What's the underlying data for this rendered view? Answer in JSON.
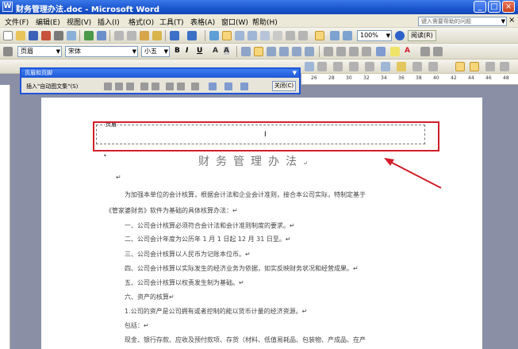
{
  "window": {
    "title": "财务管理办法.doc - Microsoft Word",
    "controls": {
      "minimize": "_",
      "maximize": "□",
      "close": "×"
    }
  },
  "menu": {
    "items": [
      "文件(F)",
      "编辑(E)",
      "视图(V)",
      "插入(I)",
      "格式(O)",
      "工具(T)",
      "表格(A)",
      "窗口(W)",
      "帮助(H)"
    ],
    "help_placeholder": "键入需要帮助的问题",
    "close_glyph": "×"
  },
  "toolbar": {
    "zoom": "100%",
    "read_label": "阅读(R)",
    "style": "页眉",
    "font": "宋体",
    "size": "小五",
    "bold": "B",
    "italic": "I",
    "underline": "U",
    "font_a": "A"
  },
  "header_footer_toolbar": {
    "title": "页眉和页脚",
    "insert_autotext": "插入\"自动图文集\"(S)",
    "close": "关闭(C)"
  },
  "ruler": {
    "numbers": [
      "26",
      "28",
      "30",
      "32",
      "34",
      "36",
      "38",
      "40",
      "42",
      "44",
      "46",
      "48"
    ]
  },
  "document": {
    "header_label": "页眉",
    "cursor": "I",
    "title": "财务管理办法",
    "return_mark": "↵",
    "lines": [
      "为加强本单位的会计核算，根据会计法和企业会计准则，接合本公司实际，特制定基于",
      "《管家婆财务》软件为基础的具体核算办法：↵",
      "一、公司会计核算必须符合会计法和会计准则制度的要求。↵",
      "二、公司会计年度为公历年 1 月 1 日起 12 月 31 日至。↵",
      "三、公司会计核算以人民币为记账本位币。↵",
      "四、公司会计核算以实际发生的经济业务为依据，如实反映财务状况和经营成果。↵",
      "五、公司会计核算以权责发生制为基础。↵",
      "六、资产的核算↵",
      "1.公司的资产是公司拥有或者控制的能以货币计量的经济资源。↵",
      "包括：↵",
      "现金、银行存款、应收及预付款项、存货（材料、低值易耗品、包装物、产成品、在产"
    ]
  },
  "colors": {
    "highlight": "#d21e2a",
    "titlebar": "#1a55cf"
  }
}
